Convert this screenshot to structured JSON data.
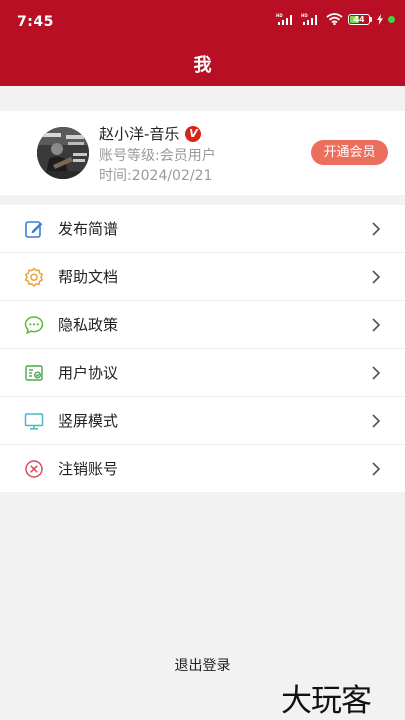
{
  "status_bar": {
    "time": "7:45",
    "battery_level": "44",
    "colors": {
      "background": "#b90f25",
      "battery_fill": "#8bd34a",
      "dot": "#47d147"
    }
  },
  "header": {
    "title": "我"
  },
  "profile": {
    "name": "赵小洋-音乐",
    "verified_badge": "V",
    "level": "账号等级:会员用户",
    "date": "时间:2024/02/21",
    "vip_button_label": "开通会员",
    "vip_button_color": "#ec6e5c"
  },
  "menu": {
    "items": [
      {
        "label": "发布简谱",
        "icon": "edit-icon"
      },
      {
        "label": "帮助文档",
        "icon": "gear-icon"
      },
      {
        "label": "隐私政策",
        "icon": "chat-bubble-icon"
      },
      {
        "label": "用户协议",
        "icon": "agreement-icon"
      },
      {
        "label": "竖屏模式",
        "icon": "monitor-icon"
      },
      {
        "label": "注销账号",
        "icon": "cancel-icon"
      }
    ]
  },
  "logout_label": "退出登录",
  "watermark": "大玩客"
}
